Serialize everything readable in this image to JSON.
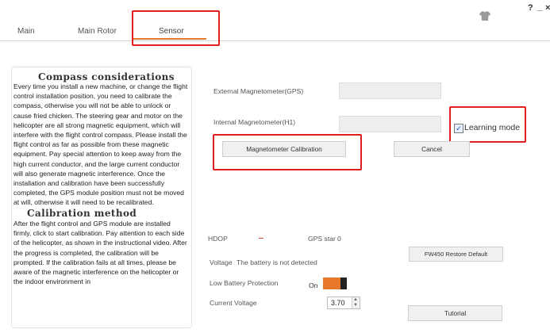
{
  "tabs": [
    {
      "label": "Main"
    },
    {
      "label": "Main Rotor"
    },
    {
      "label": "Sensor",
      "active": true
    }
  ],
  "window_controls": {
    "help": "?",
    "minimize": "_"
  },
  "accent_color": "#e8792a",
  "compass": {
    "title": "Compass considerations",
    "text": "Every time you install a new machine, or change the flight control installation position, you need to calibrate the compass, otherwise you will not be able to unlock or cause fried chicken. The steering gear and motor on the helicopter are all strong magnetic equipment, which will interfere with the flight control compass. Please install the flight control as far as possible from these magnetic equipment. Pay special attention to keep away from the high current conductor, and the large current conductor will also generate magnetic interference. Once the installation and calibration have been successfully completed, the GPS module position must not be moved at will, otherwise it will need to be recalibrated."
  },
  "calibration": {
    "title": "Calibration method",
    "text": "After the flight control and GPS module are installed firmly, click to start calibration. Pay attention to each side of the helicopter, as shown in the instructional video. After the progress is completed, the calibration will be prompted. If the calibration fails at all times, please be aware of the magnetic interference on the helicopter or the indoor environment in"
  },
  "sensors": {
    "external_label": "External Magnetometer(GPS)",
    "internal_label": "Internal Magnetometer(H1)",
    "learning_mode_label": "Learning mode",
    "learning_mode_checked": true,
    "calibration_button": "Magnetometer Calibration",
    "cancel_button": "Cancel"
  },
  "status": {
    "hdop_label": "HDOP",
    "hdop_value": "--",
    "gps_star_label": "GPS star",
    "gps_star_value": "0",
    "voltage_label": "Voltage",
    "voltage_status": "The battery is not detected",
    "low_battery_label": "Low Battery Protection",
    "low_battery_state": "On",
    "current_voltage_label": "Current Voltage",
    "current_voltage_value": "3.70",
    "restore_button": "FW450 Restore Default",
    "tutorial_button": "Tutorial"
  }
}
